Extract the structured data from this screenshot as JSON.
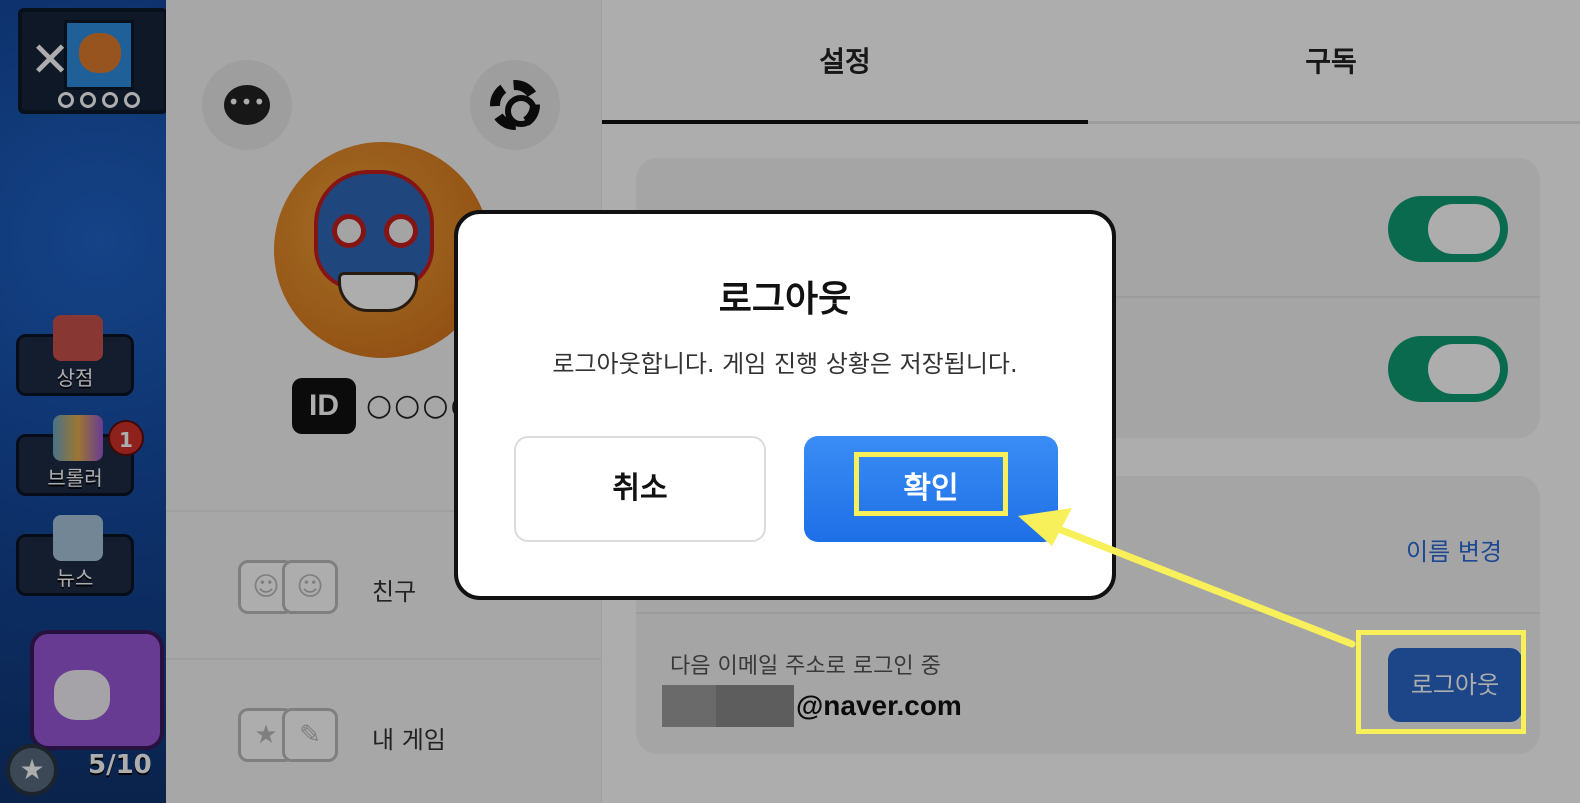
{
  "game": {
    "close_icon": "✕",
    "buttons": [
      {
        "label": "상점"
      },
      {
        "label": "브롤러"
      },
      {
        "label": "뉴스"
      }
    ],
    "notification_count": "1",
    "progress": "5/10"
  },
  "sidebar": {
    "chat_icon_text": "•••",
    "id_badge": "ID",
    "id_value": "○○○○",
    "menu": [
      {
        "label": "친구"
      },
      {
        "label": "내 게임"
      }
    ]
  },
  "tabs": [
    {
      "label": "설정",
      "active": true
    },
    {
      "label": "구독",
      "active": false
    }
  ],
  "settings": {
    "toggles": [
      true,
      true
    ],
    "rename_link": "이름 변경",
    "login_hint": "다음 이메일 주소로 로그인 중",
    "email_domain": "@naver.com",
    "logout_button": "로그아웃"
  },
  "modal": {
    "title": "로그아웃",
    "message": "로그아웃합니다. 게임 진행 상황은 저장됩니다.",
    "cancel_label": "취소",
    "confirm_label": "확인"
  },
  "colors": {
    "toggle_on": "#0f9d74",
    "primary_blue": "#1e6fe6",
    "link_blue": "#2c6ad8",
    "highlight": "#f7f05a"
  }
}
